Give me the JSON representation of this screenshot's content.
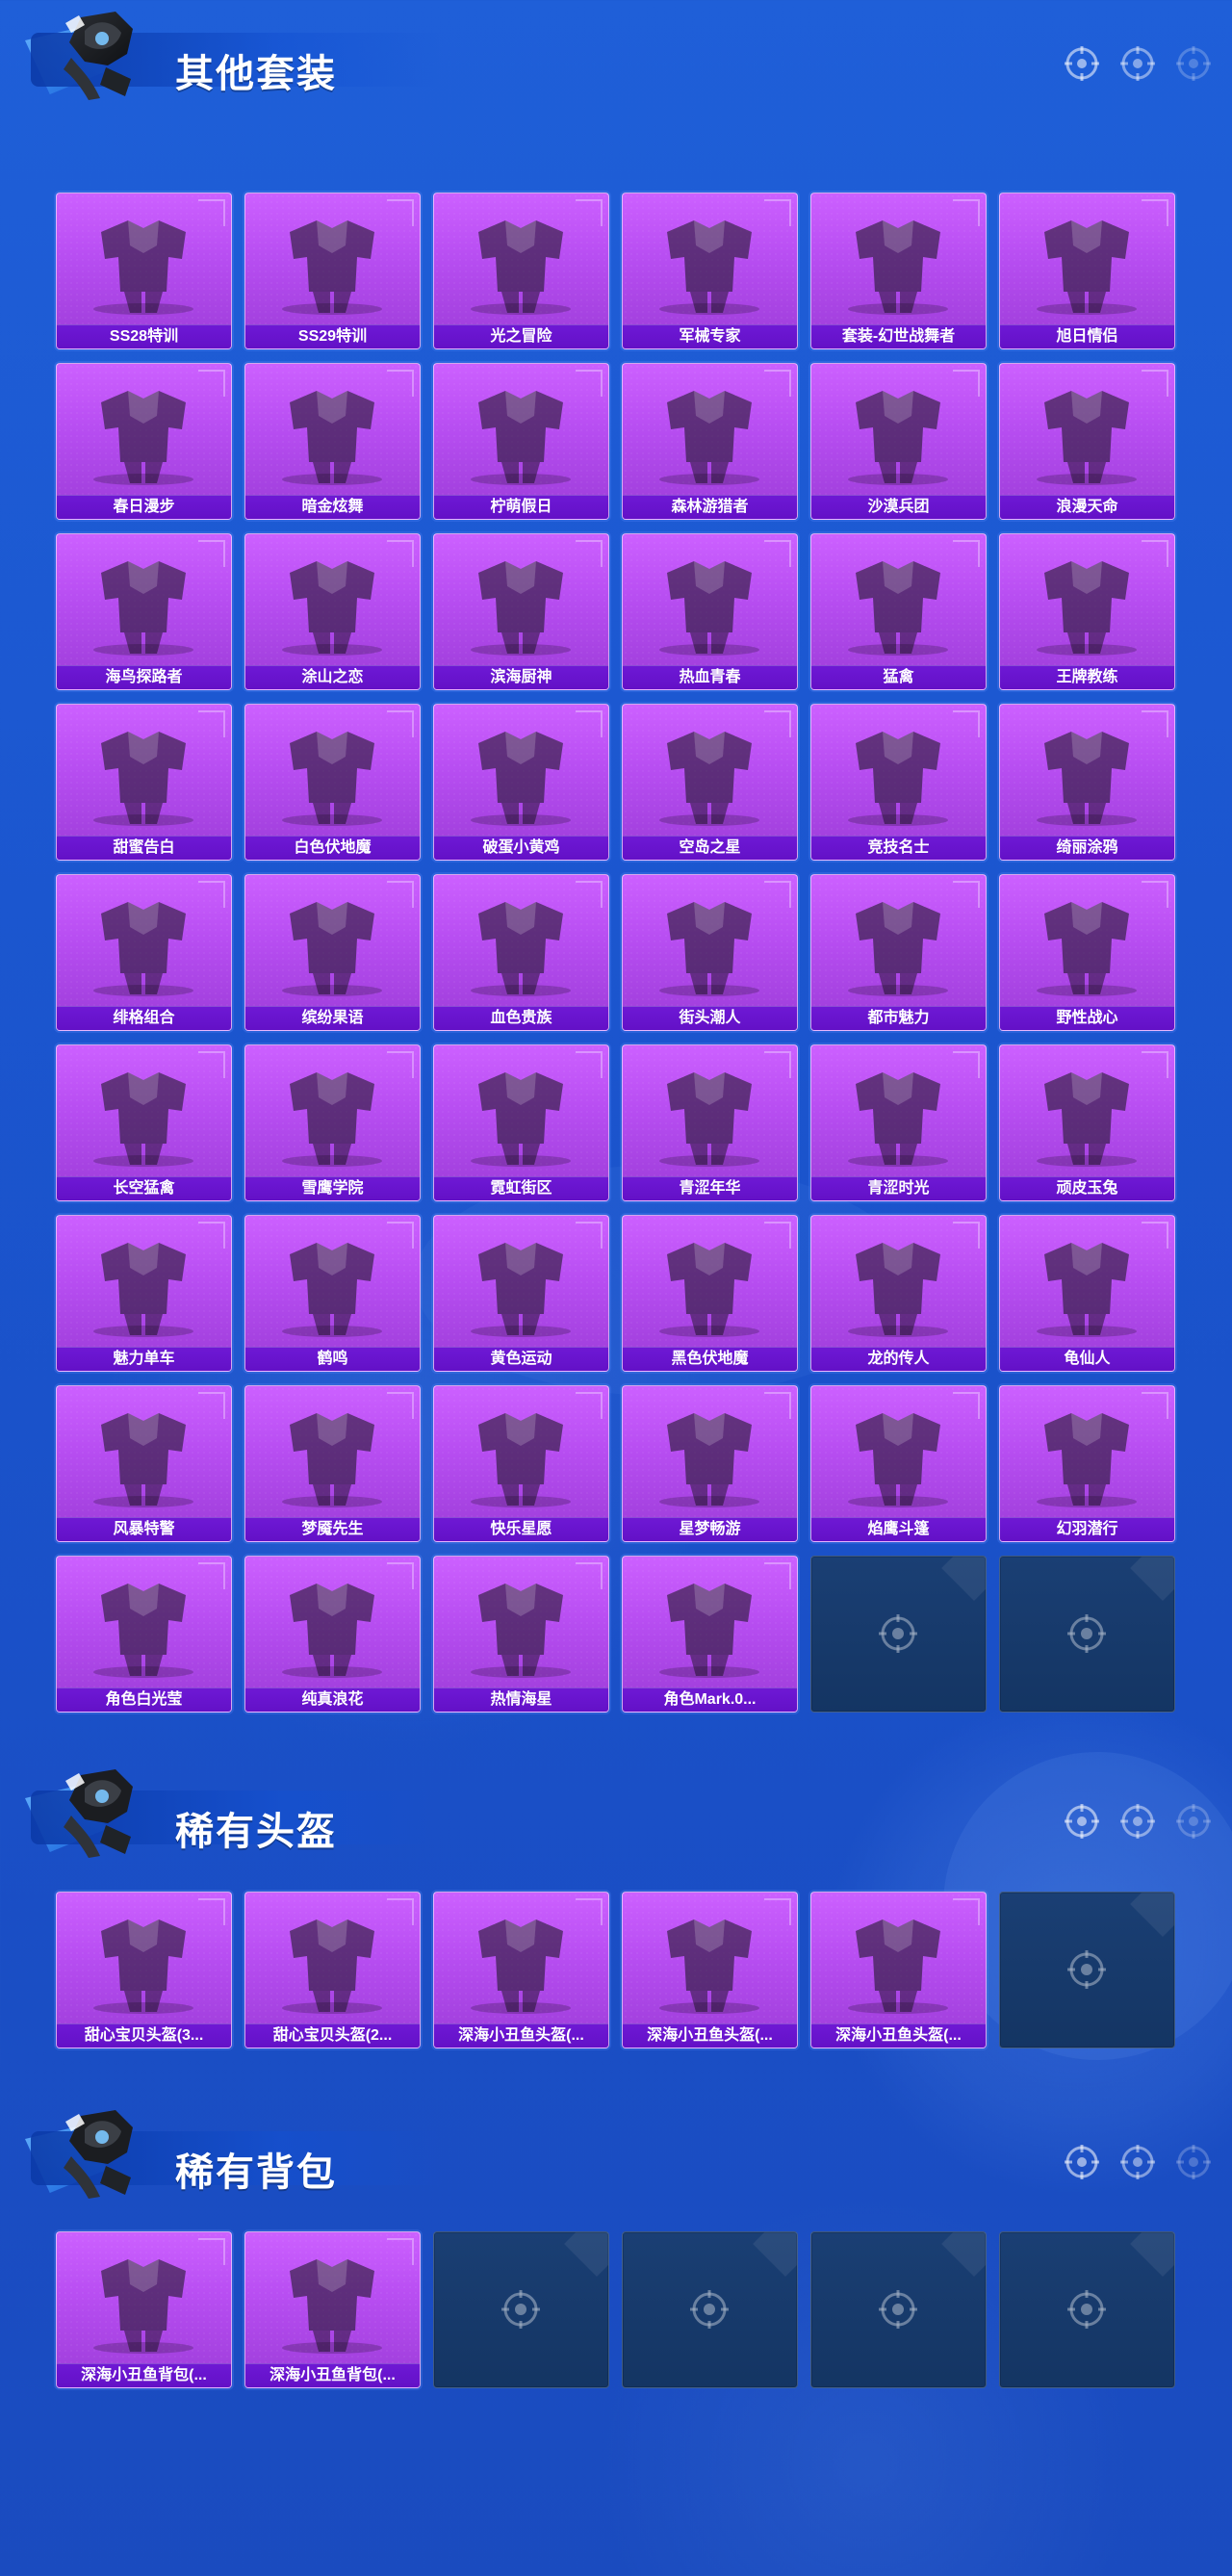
{
  "sections": [
    {
      "title": "其他套装",
      "items": [
        {
          "label": "SS28特训"
        },
        {
          "label": "SS29特训"
        },
        {
          "label": "光之冒险"
        },
        {
          "label": "军械专家"
        },
        {
          "label": "套装-幻世战舞者"
        },
        {
          "label": "旭日情侣"
        },
        {
          "label": "春日漫步"
        },
        {
          "label": "暗金炫舞"
        },
        {
          "label": "柠萌假日"
        },
        {
          "label": "森林游猎者"
        },
        {
          "label": "沙漠兵团"
        },
        {
          "label": "浪漫天命"
        },
        {
          "label": "海鸟探路者"
        },
        {
          "label": "涂山之恋"
        },
        {
          "label": "滨海厨神"
        },
        {
          "label": "热血青春"
        },
        {
          "label": "猛禽"
        },
        {
          "label": "王牌教练"
        },
        {
          "label": "甜蜜告白"
        },
        {
          "label": "白色伏地魔"
        },
        {
          "label": "破蛋小黄鸡"
        },
        {
          "label": "空岛之星"
        },
        {
          "label": "竞技名士"
        },
        {
          "label": "绮丽涂鸦"
        },
        {
          "label": "绯格组合"
        },
        {
          "label": "缤纷果语"
        },
        {
          "label": "血色贵族"
        },
        {
          "label": "街头潮人"
        },
        {
          "label": "都市魅力"
        },
        {
          "label": "野性战心"
        },
        {
          "label": "长空猛禽"
        },
        {
          "label": "雪鹰学院"
        },
        {
          "label": "霓虹街区"
        },
        {
          "label": "青涩年华"
        },
        {
          "label": "青涩时光"
        },
        {
          "label": "顽皮玉兔"
        },
        {
          "label": "魅力单车"
        },
        {
          "label": "鹤鸣"
        },
        {
          "label": "黄色运动"
        },
        {
          "label": "黑色伏地魔"
        },
        {
          "label": "龙的传人"
        },
        {
          "label": "龟仙人"
        },
        {
          "label": "风暴特警"
        },
        {
          "label": "梦魇先生"
        },
        {
          "label": "快乐星愿"
        },
        {
          "label": "星梦畅游"
        },
        {
          "label": "焰鹰斗篷"
        },
        {
          "label": "幻羽潜行"
        },
        {
          "label": "角色白光莹"
        },
        {
          "label": "纯真浪花"
        },
        {
          "label": "热情海星"
        },
        {
          "label": "角色Mark.0..."
        }
      ],
      "empty_slots": 2
    },
    {
      "title": "稀有头盔",
      "items": [
        {
          "label": "甜心宝贝头盔(3..."
        },
        {
          "label": "甜心宝贝头盔(2..."
        },
        {
          "label": "深海小丑鱼头盔(..."
        },
        {
          "label": "深海小丑鱼头盔(..."
        },
        {
          "label": "深海小丑鱼头盔(..."
        }
      ],
      "empty_slots": 1
    },
    {
      "title": "稀有背包",
      "items": [
        {
          "label": "深海小丑鱼背包(..."
        },
        {
          "label": "深海小丑鱼背包(..."
        }
      ],
      "empty_slots": 4
    }
  ],
  "colors": {
    "background": "#1b56cf",
    "card_purple": "#b84ef2",
    "label_bar": "#6a12d0",
    "empty_card": "#163a6b"
  },
  "icons": {
    "header_dots": [
      "target-icon",
      "target-icon",
      "target-icon"
    ],
    "empty_slot": "target-icon",
    "mascot": "mascot-icon",
    "item_art": "outfit-icon"
  }
}
